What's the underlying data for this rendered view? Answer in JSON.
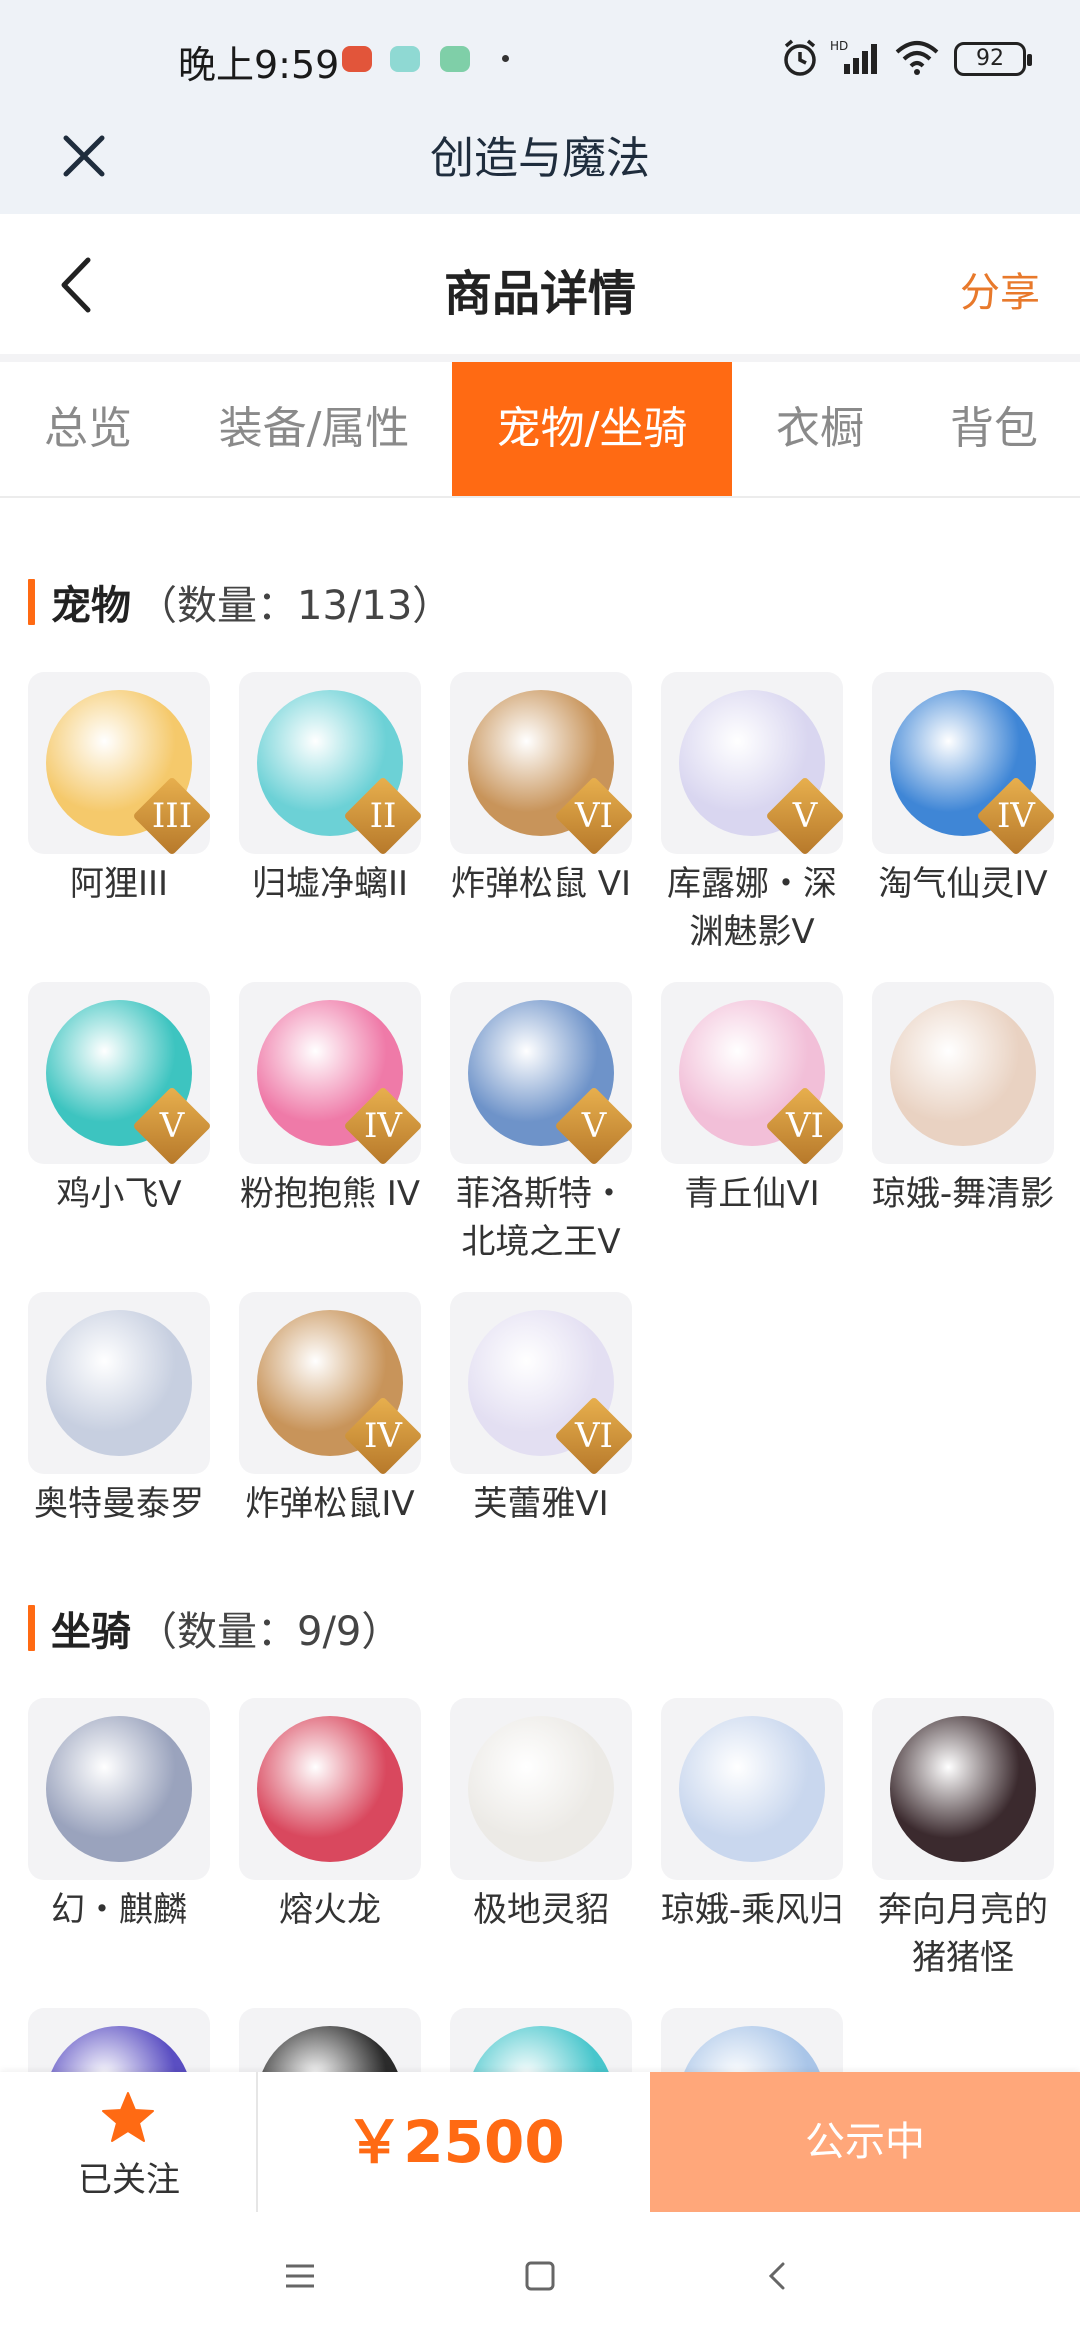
{
  "status_bar": {
    "time": "晚上9:59",
    "battery": "92"
  },
  "app": {
    "title": "创造与魔法"
  },
  "header": {
    "title": "商品详情",
    "share_label": "分享"
  },
  "tabs": [
    {
      "label": "总览"
    },
    {
      "label": "装备/属性"
    },
    {
      "label": "宠物/坐骑",
      "active": true
    },
    {
      "label": "衣橱"
    },
    {
      "label": "背包"
    }
  ],
  "pets": {
    "title": "宠物",
    "count": "（数量：13/13）",
    "items": [
      {
        "name": "阿狸III",
        "tier": "III",
        "color": "#f5c96b"
      },
      {
        "name": "归墟净螭II",
        "tier": "II",
        "color": "#6cd1d6"
      },
      {
        "name": "炸弹松鼠 VI",
        "tier": "VI",
        "color": "#c8945a"
      },
      {
        "name": "库露娜・深渊魅影V",
        "tier": "V",
        "color": "#d9d6f0"
      },
      {
        "name": "淘气仙灵IV",
        "tier": "IV",
        "color": "#3f86d6"
      },
      {
        "name": "鸡小飞V",
        "tier": "V",
        "color": "#3dc4c0"
      },
      {
        "name": "粉抱抱熊 IV",
        "tier": "IV",
        "color": "#ef7aa8"
      },
      {
        "name": "菲洛斯特・北境之王V",
        "tier": "V",
        "color": "#6e93c9"
      },
      {
        "name": "青丘仙VI",
        "tier": "VI",
        "color": "#f2bfd8"
      },
      {
        "name": "琼娥-舞清影",
        "tier": "",
        "color": "#e9d2c2"
      },
      {
        "name": "奥特曼泰罗",
        "tier": "",
        "color": "#c7cfe0"
      },
      {
        "name": "炸弹松鼠IV",
        "tier": "IV",
        "color": "#c8945a"
      },
      {
        "name": "芙蕾雅VI",
        "tier": "VI",
        "color": "#e3dff2"
      }
    ]
  },
  "mounts": {
    "title": "坐骑",
    "count": "（数量：9/9）",
    "items": [
      {
        "name": "幻・麒麟",
        "tier": "",
        "color": "#9aa3bd"
      },
      {
        "name": "熔火龙",
        "tier": "",
        "color": "#d9485e"
      },
      {
        "name": "极地灵貂",
        "tier": "",
        "color": "#eceae6"
      },
      {
        "name": "琼娥-乘风归",
        "tier": "",
        "color": "#c9d7ee"
      },
      {
        "name": "奔向月亮的猪猪怪",
        "tier": "",
        "color": "#3b2a2e"
      },
      {
        "name": "",
        "tier": "",
        "color": "#5a4ec2"
      },
      {
        "name": "",
        "tier": "",
        "color": "#2b2b2b"
      },
      {
        "name": "",
        "tier": "",
        "color": "#48c6cc"
      },
      {
        "name": "",
        "tier": "",
        "color": "#a9c5e8"
      }
    ]
  },
  "bottom": {
    "follow_label": "已关注",
    "price": "￥2500",
    "status_button": "公示中"
  },
  "colors": {
    "accent": "#ff6a13",
    "share": "#e8792b"
  }
}
